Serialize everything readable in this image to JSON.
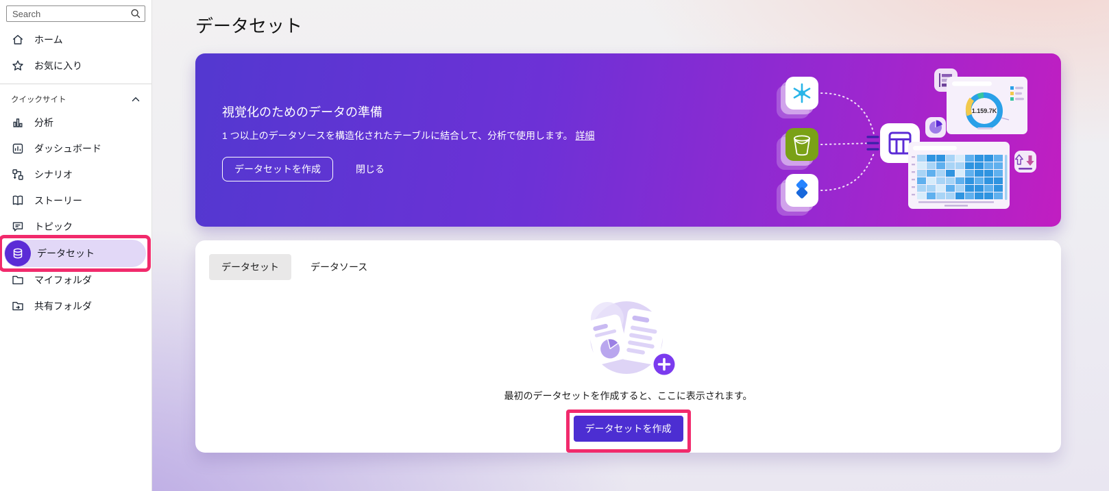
{
  "sidebar": {
    "search_placeholder": "Search",
    "top_items": [
      {
        "label": "ホーム"
      },
      {
        "label": "お気に入り"
      }
    ],
    "section_label": "クイックサイト",
    "items": [
      {
        "label": "分析"
      },
      {
        "label": "ダッシュボード"
      },
      {
        "label": "シナリオ"
      },
      {
        "label": "ストーリー"
      },
      {
        "label": "トピック"
      },
      {
        "label": "データセット",
        "selected": true
      },
      {
        "label": "マイフォルダ"
      },
      {
        "label": "共有フォルダ"
      }
    ]
  },
  "page": {
    "title": "データセット"
  },
  "banner": {
    "title": "視覚化のためのデータの準備",
    "description": "1 つ以上のデータソースを構造化されたテーブルに結合して、分析で使用します。",
    "link_label": "詳細",
    "create_label": "データセットを作成",
    "close_label": "閉じる",
    "illustration": {
      "donut_value": "1.159.7K"
    }
  },
  "content": {
    "tabs": [
      {
        "label": "データセット",
        "selected": true
      },
      {
        "label": "データソース",
        "selected": false
      }
    ],
    "empty": {
      "message": "最初のデータセットを作成すると、ここに表示されます。",
      "create_label": "データセットを作成"
    }
  },
  "colors": {
    "annotation_pink": "#F12A6C",
    "accent_purple": "#4C2ED2",
    "dataset_circle": "#5B2BD6",
    "selected_pill": "#E2D8F7",
    "banner_gradient_start": "#5338D0",
    "banner_gradient_end": "#C11EC1"
  }
}
